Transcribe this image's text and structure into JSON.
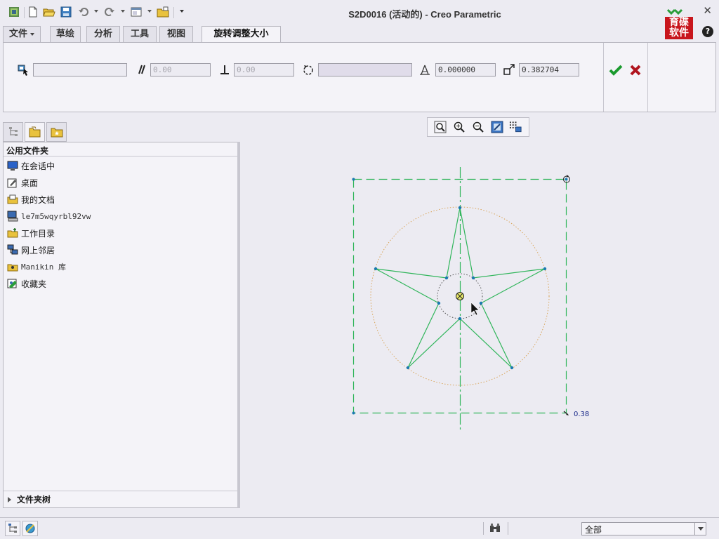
{
  "window": {
    "title": "S2D0016 (活动的) - Creo Parametric",
    "close_glyph": "✕",
    "help_glyph": "?",
    "logo_lines": [
      "育碟",
      "软件"
    ],
    "logo_accent": "#c8161d"
  },
  "quick_access": {
    "icons": [
      "app-icon",
      "new-icon",
      "open-icon",
      "save-icon",
      "undo-icon",
      "redo-icon",
      "window-icon",
      "folder-icon",
      "customize-icon"
    ]
  },
  "ribbon": {
    "tabs": [
      {
        "label": "文件",
        "has_dropdown": true
      },
      {
        "label": "草绘"
      },
      {
        "label": "分析"
      },
      {
        "label": "工具"
      },
      {
        "label": "视图"
      },
      {
        "label": "旋转调整大小",
        "active": true
      }
    ]
  },
  "dashboard": {
    "reference_value": "",
    "horizontal_move": "0.00",
    "vertical_move": "0.00",
    "rotation_reference": "",
    "rotate_angle": "0.000000",
    "scale_value": "0.382704"
  },
  "navigator": {
    "tabs": [
      "model-tree-tab",
      "folder-browser-tab",
      "favorites-tab"
    ],
    "header": "公用文件夹",
    "items": [
      {
        "label": "在会话中",
        "icon": "in-session-icon"
      },
      {
        "label": "桌面",
        "icon": "desktop-icon"
      },
      {
        "label": "我的文档",
        "icon": "my-documents-icon"
      },
      {
        "label": "le7m5wqyrbl92vw",
        "icon": "computer-icon",
        "mono": true
      },
      {
        "label": "工作目录",
        "icon": "working-directory-icon"
      },
      {
        "label": "网上邻居",
        "icon": "network-icon"
      },
      {
        "label": "Manikin 库",
        "icon": "manikin-library-icon",
        "mono": true
      },
      {
        "label": "收藏夹",
        "icon": "favorites-icon"
      }
    ],
    "folder_tree_label": "文件夹树"
  },
  "graphics_toolbar": {
    "buttons": [
      "refit-icon",
      "zoom-in-icon",
      "zoom-out-icon",
      "repaint-icon",
      "display-filter-icon"
    ]
  },
  "sketch": {
    "scale_label": "0.38"
  },
  "status": {
    "filter_value": "全部"
  },
  "colors": {
    "background": "#ecebf2",
    "sketch_line": "#2fb55a",
    "sketch_vertex": "#1a7ab0",
    "construction_circle": "#d9a55a",
    "ok_green": "#1a9a2e",
    "cancel_red": "#b0141e"
  }
}
